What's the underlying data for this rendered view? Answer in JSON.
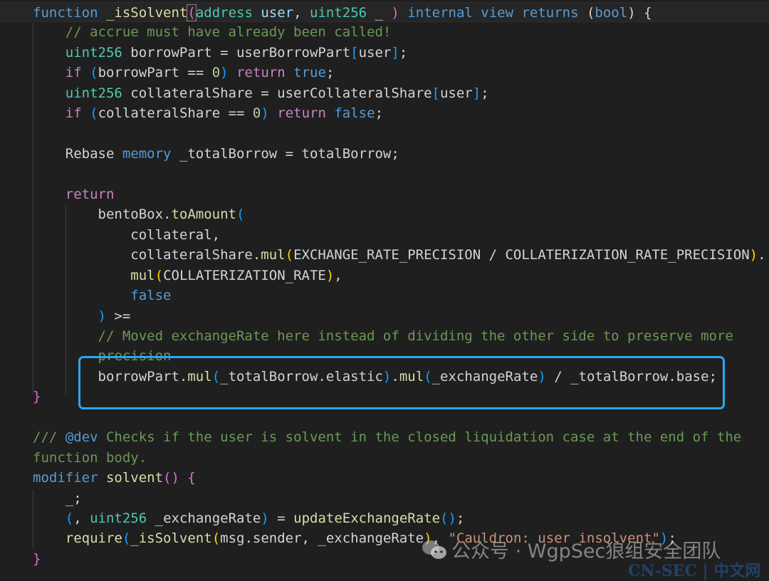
{
  "editor": {
    "lines": [
      [
        [
          "kw",
          "function"
        ],
        [
          "tx",
          " "
        ],
        [
          "fn",
          "_isSolvent"
        ],
        [
          "bp pb",
          "("
        ],
        [
          "ty",
          "address"
        ],
        [
          "tx",
          " "
        ],
        [
          "va",
          "user"
        ],
        [
          "tx",
          ", "
        ],
        [
          "ty",
          "uint256"
        ],
        [
          "tx",
          " _ "
        ],
        [
          "bp",
          ")"
        ],
        [
          "tx",
          " "
        ],
        [
          "kw",
          "internal view returns"
        ],
        [
          "tx",
          " ("
        ],
        [
          "kw",
          "bool"
        ],
        [
          "tx",
          ") {"
        ]
      ],
      [
        [
          "tx",
          "    "
        ],
        [
          "cm",
          "// accrue must have already been called!"
        ]
      ],
      [
        [
          "tx",
          "    "
        ],
        [
          "ty",
          "uint256"
        ],
        [
          "tx",
          " borrowPart = userBorrowPart"
        ],
        [
          "bb",
          "["
        ],
        [
          "tx",
          "user"
        ],
        [
          "bb",
          "]"
        ],
        [
          "tx",
          ";"
        ]
      ],
      [
        [
          "tx",
          "    "
        ],
        [
          "ct",
          "if"
        ],
        [
          "tx",
          " "
        ],
        [
          "bb",
          "("
        ],
        [
          "tx",
          "borrowPart == "
        ],
        [
          "nu",
          "0"
        ],
        [
          "bb",
          ")"
        ],
        [
          "tx",
          " "
        ],
        [
          "ct",
          "return"
        ],
        [
          "tx",
          " "
        ],
        [
          "kw",
          "true"
        ],
        [
          "tx",
          ";"
        ]
      ],
      [
        [
          "tx",
          "    "
        ],
        [
          "ty",
          "uint256"
        ],
        [
          "tx",
          " collateralShare = userCollateralShare"
        ],
        [
          "bb",
          "["
        ],
        [
          "tx",
          "user"
        ],
        [
          "bb",
          "]"
        ],
        [
          "tx",
          ";"
        ]
      ],
      [
        [
          "tx",
          "    "
        ],
        [
          "ct",
          "if"
        ],
        [
          "tx",
          " "
        ],
        [
          "bb",
          "("
        ],
        [
          "tx",
          "collateralShare == "
        ],
        [
          "nu",
          "0"
        ],
        [
          "bb",
          ")"
        ],
        [
          "tx",
          " "
        ],
        [
          "ct",
          "return"
        ],
        [
          "tx",
          " "
        ],
        [
          "kw",
          "false"
        ],
        [
          "tx",
          ";"
        ]
      ],
      [],
      [
        [
          "tx",
          "    Rebase "
        ],
        [
          "kw",
          "memory"
        ],
        [
          "tx",
          " _totalBorrow = totalBorrow;"
        ]
      ],
      [],
      [
        [
          "tx",
          "    "
        ],
        [
          "ct",
          "return"
        ]
      ],
      [
        [
          "tx",
          "        bentoBox."
        ],
        [
          "fn",
          "toAmount"
        ],
        [
          "bb",
          "("
        ]
      ],
      [
        [
          "tx",
          "            collateral,"
        ]
      ],
      [
        [
          "tx",
          "            collateralShare."
        ],
        [
          "fn",
          "mul"
        ],
        [
          "by",
          "("
        ],
        [
          "tx",
          "EXCHANGE_RATE_PRECISION / COLLATERIZATION_RATE_PRECISION"
        ],
        [
          "by",
          ")"
        ],
        [
          "tx",
          "."
        ]
      ],
      [
        [
          "tx",
          "            "
        ],
        [
          "fn",
          "mul"
        ],
        [
          "by",
          "("
        ],
        [
          "tx",
          "COLLATERIZATION_RATE"
        ],
        [
          "by",
          ")"
        ],
        [
          "tx",
          ","
        ]
      ],
      [
        [
          "tx",
          "            "
        ],
        [
          "kw",
          "false"
        ]
      ],
      [
        [
          "tx",
          "        "
        ],
        [
          "bb",
          ")"
        ],
        [
          "tx",
          " >="
        ]
      ],
      [
        [
          "tx",
          "        "
        ],
        [
          "cm",
          "// Moved exchangeRate here instead of dividing the other side to preserve more"
        ]
      ],
      [
        [
          "tx",
          "        "
        ],
        [
          "cm",
          "precision"
        ]
      ],
      [
        [
          "tx",
          "        borrowPart."
        ],
        [
          "fn",
          "mul"
        ],
        [
          "bb",
          "("
        ],
        [
          "tx",
          "_totalBorrow.elastic"
        ],
        [
          "bb",
          ")"
        ],
        [
          "tx",
          "."
        ],
        [
          "fn",
          "mul"
        ],
        [
          "bb",
          "("
        ],
        [
          "tx",
          "_exchangeRate"
        ],
        [
          "bb",
          ")"
        ],
        [
          "tx",
          " / _totalBorrow.base;"
        ]
      ],
      [
        [
          "bp",
          "}"
        ]
      ],
      [],
      [
        [
          "cm",
          "/// "
        ],
        [
          "kw",
          "@dev"
        ],
        [
          "cm",
          " Checks if the user is solvent in the closed liquidation case at the end of the"
        ]
      ],
      [
        [
          "cm",
          "function body."
        ]
      ],
      [
        [
          "kw",
          "modifier"
        ],
        [
          "tx",
          " "
        ],
        [
          "fn",
          "solvent"
        ],
        [
          "bp",
          "()"
        ],
        [
          "tx",
          " "
        ],
        [
          "bp",
          "{"
        ]
      ],
      [
        [
          "tx",
          "    _;"
        ]
      ],
      [
        [
          "tx",
          "    "
        ],
        [
          "bb",
          "("
        ],
        [
          "tx",
          ", "
        ],
        [
          "ty",
          "uint256"
        ],
        [
          "tx",
          " _exchangeRate"
        ],
        [
          "bb",
          ")"
        ],
        [
          "tx",
          " = "
        ],
        [
          "fn",
          "updateExchangeRate"
        ],
        [
          "bb",
          "()"
        ],
        [
          "tx",
          ";"
        ]
      ],
      [
        [
          "tx",
          "    "
        ],
        [
          "fn",
          "require"
        ],
        [
          "bb",
          "("
        ],
        [
          "fn",
          "_isSolvent"
        ],
        [
          "by",
          "("
        ],
        [
          "tx",
          "msg.sender, _exchangeRate"
        ],
        [
          "by",
          ")"
        ],
        [
          "tx",
          ", "
        ],
        [
          "st",
          "\"Cauldron: user insolvent\""
        ],
        [
          "bb",
          ")"
        ],
        [
          "tx",
          ";"
        ]
      ],
      [
        [
          "bp",
          "}"
        ]
      ]
    ]
  },
  "watermark": {
    "text": "公众号 · WgpSec狼组安全团队",
    "icon": "wechat-icon"
  },
  "site_mark": {
    "text": "CN-SEC | 中文网"
  },
  "colors": {
    "highlight_box": "#2aa8ee",
    "background": "#1f1f1f"
  }
}
